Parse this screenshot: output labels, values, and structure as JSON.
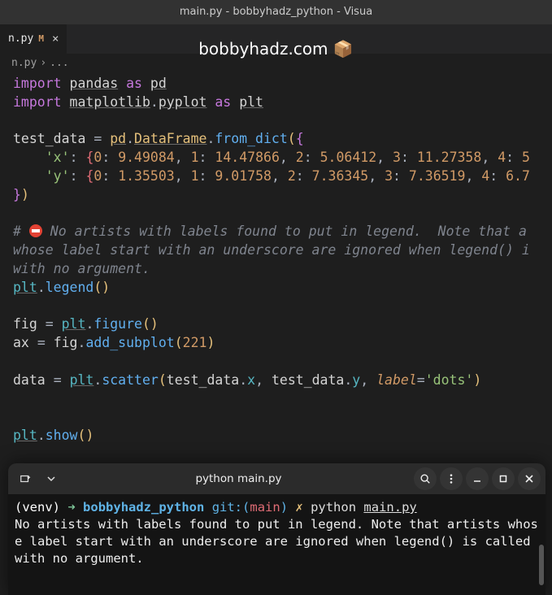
{
  "title_bar": "main.py - bobbyhadz_python - Visua",
  "tab": {
    "label": "n.py",
    "modified": "M",
    "close": "×"
  },
  "watermark": "bobbyhadz.com 📦",
  "breadcrumb": {
    "file": "n.py",
    "sep": "›",
    "more": "..."
  },
  "code": {
    "l1": {
      "import": "import",
      "pandas": "pandas",
      "as": "as",
      "pd": "pd"
    },
    "l2": {
      "import": "import",
      "matplotlib": "matplotlib",
      "pyplot": "pyplot",
      "as": "as",
      "plt": "plt"
    },
    "l4": {
      "var": "test_data",
      "eq": "=",
      "pd": "pd",
      "DataFrame": "DataFrame",
      "from_dict": "from_dict"
    },
    "l5": {
      "key": "'x'",
      "vals": {
        "k0": "0",
        "v0": "9.49084",
        "k1": "1",
        "v1": "14.47866",
        "k2": "2",
        "v2": "5.06412",
        "k3": "3",
        "v3": "11.27358",
        "k4": "4",
        "v4": "5"
      }
    },
    "l6": {
      "key": "'y'",
      "vals": {
        "k0": "0",
        "v0": "1.35503",
        "k1": "1",
        "v1": "9.01758",
        "k2": "2",
        "v2": "7.36345",
        "k3": "3",
        "v3": "7.36519",
        "k4": "4",
        "v4": "6.7"
      }
    },
    "comment": {
      "a": "# ",
      "b": " No artists with labels found to put in legend.  Note that a",
      "c": "whose label start with an underscore are ignored when legend() i",
      "d": "with no argument."
    },
    "l11": {
      "plt": "plt",
      "legend": "legend"
    },
    "l13": {
      "fig": "fig",
      "eq": "=",
      "plt": "plt",
      "figure": "figure"
    },
    "l14": {
      "ax": "ax",
      "eq": "=",
      "fig": "fig",
      "add_subplot": "add_subplot",
      "n": "221"
    },
    "l16": {
      "data": "data",
      "eq": "=",
      "plt": "plt",
      "scatter": "scatter",
      "tx": "test_data",
      "x": "x",
      "ty": "test_data",
      "y": "y",
      "label": "label",
      "val": "'dots'"
    },
    "l19": {
      "plt": "plt",
      "show": "show"
    }
  },
  "terminal": {
    "title": "python main.py",
    "prompt": {
      "venv": "(venv)",
      "arrow": "➜",
      "dir": "bobbyhadz_python",
      "git": "git:(",
      "branch": "main",
      "gitc": ")",
      "x": "✗",
      "cmd": "python",
      "file": "main.py"
    },
    "output": "No artists with labels found to put in legend.  Note that artists whose label start with an underscore are ignored when legend() is called with no argument."
  }
}
